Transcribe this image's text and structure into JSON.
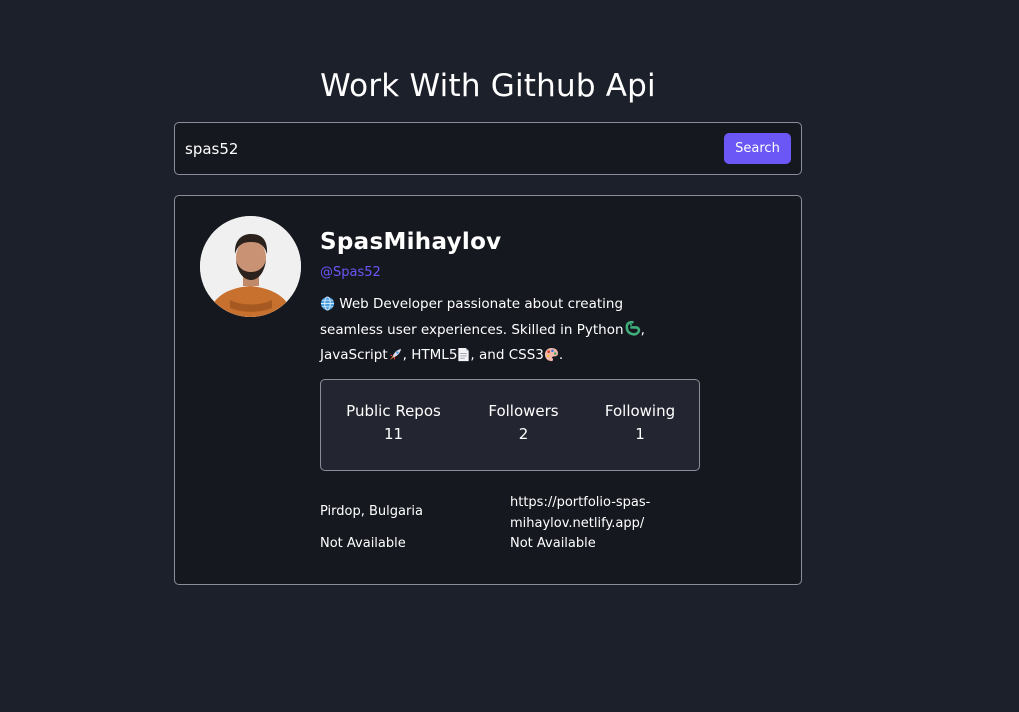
{
  "page": {
    "title": "Work With Github Api"
  },
  "search": {
    "value": "spas52",
    "button_label": "Search"
  },
  "profile": {
    "name": "SpasMihaylov",
    "handle": "@Spas52",
    "bio": {
      "part1": " Web Developer passionate about creating seamless user experiences. Skilled in Python",
      "part2": ", JavaScript",
      "part3": ", HTML5",
      "part4": ", and CSS3",
      "part5": "."
    },
    "emoji": [
      "globe-emoji",
      "python-emoji",
      "rocket-emoji",
      "page-emoji",
      "palette-emoji"
    ],
    "stats": {
      "repos_label": "Public Repos",
      "repos_value": "11",
      "followers_label": "Followers",
      "followers_value": "2",
      "following_label": "Following",
      "following_value": "1"
    },
    "info": {
      "location": "Pirdop, Bulgaria",
      "blog": "https://portfolio-spas-mihaylov.netlify.app/",
      "twitter": "Not Available",
      "company": "Not Available"
    }
  },
  "colors": {
    "background": "#1c202b",
    "card": "#161820",
    "accent": "#6a57f5",
    "border": "#8b8e99"
  }
}
